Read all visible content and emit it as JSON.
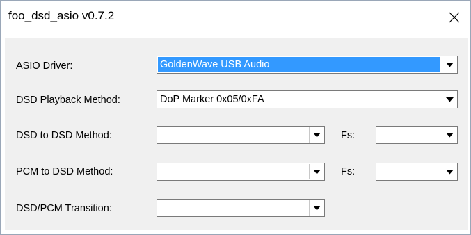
{
  "window": {
    "title": "foo_dsd_asio v0.7.2"
  },
  "form": {
    "asio_driver": {
      "label": "ASIO Driver:",
      "value": "GoldenWave USB Audio"
    },
    "dsd_playback_method": {
      "label": "DSD Playback Method:",
      "value": "DoP Marker 0x05/0xFA"
    },
    "dsd_to_dsd_method": {
      "label": "DSD to DSD Method:",
      "value": "",
      "fs_label": "Fs:",
      "fs_value": ""
    },
    "pcm_to_dsd_method": {
      "label": "PCM to DSD Method:",
      "value": "",
      "fs_label": "Fs:",
      "fs_value": ""
    },
    "dsd_pcm_transition": {
      "label": "DSD/PCM Transition:",
      "value": ""
    }
  },
  "icons": {
    "close": "close-icon",
    "dropdown": "chevron-down-icon"
  },
  "colors": {
    "selection": "#3399ff",
    "client_bg": "#f0f0f0",
    "border": "#7a7a7a"
  }
}
